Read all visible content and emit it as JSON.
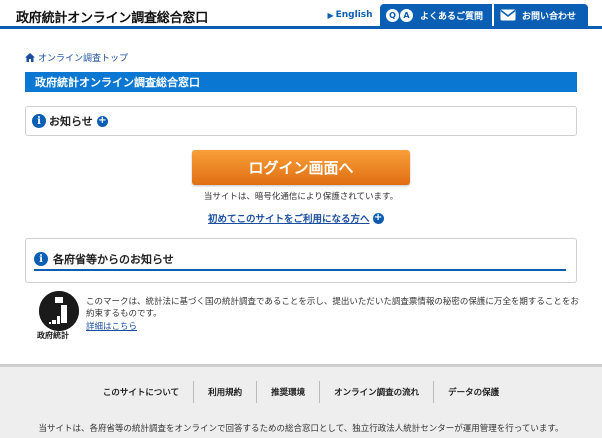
{
  "header": {
    "site_title": "政府統計オンライン調査総合窓口",
    "english_label": "English",
    "faq_label": "よくあるご質問",
    "contact_label": "お問い合わせ",
    "qa_q": "Q",
    "qa_a": "A"
  },
  "breadcrumb": {
    "label": "オンライン調査トップ"
  },
  "page_title": "政府統計オンライン調査総合窓口",
  "notice": {
    "label": "お知らせ"
  },
  "login": {
    "button_label": "ログイン画面へ",
    "secure_text": "当サイトは、暗号化通信により保護されています。",
    "first_time_link": "初めてこのサイトをご利用になる方へ"
  },
  "agency_notice": {
    "title": "各府省等からのお知らせ"
  },
  "mark": {
    "caption": "政府統計",
    "description": "このマークは、統計法に基づく国の統計調査であることを示し、提出いただいた調査票情報の秘密の保護に万全を期することをお約束するものです。",
    "details_link": "詳細はこちら"
  },
  "footer": {
    "links": [
      {
        "label": "このサイトについて"
      },
      {
        "label": "利用規約"
      },
      {
        "label": "推奨環境"
      },
      {
        "label": "オンライン調査の流れ"
      },
      {
        "label": "データの保護"
      }
    ],
    "text": "当サイトは、各府省等の統計調査をオンラインで回答するための総合窓口として、独立行政法人統計センターが運用管理を行っています。"
  },
  "colors": {
    "brand_blue": "#0a5fb4",
    "title_bar_blue": "#0a78d2",
    "login_orange": "#f08a24",
    "footer_gray": "#eeeeee"
  },
  "icons": [
    "home-icon",
    "qa-icon",
    "mail-icon",
    "info-icon",
    "plus-icon",
    "statistics-mark-logo"
  ]
}
